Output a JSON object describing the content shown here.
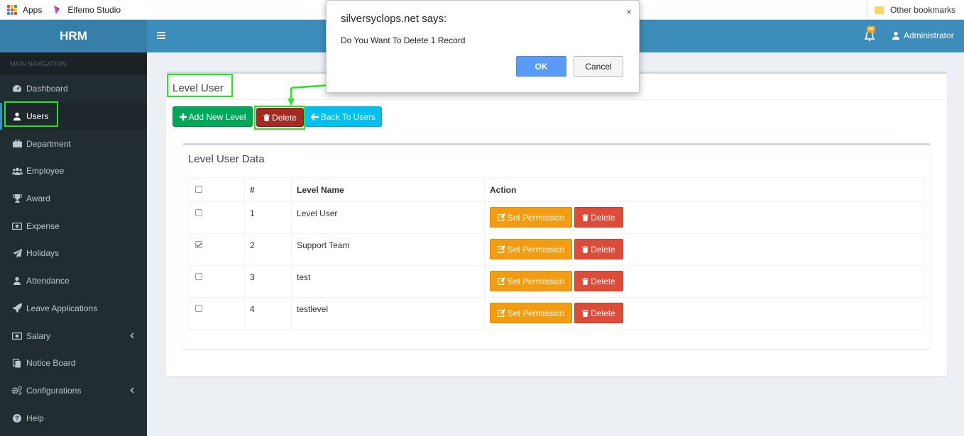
{
  "bookmarks": {
    "apps_label": "Apps",
    "elfemo_label": "Elfemo Studio",
    "other_label": "Other bookmarks"
  },
  "sidebar": {
    "logo": "HRM",
    "header": "MAIN NAVIGATION",
    "items": [
      {
        "label": "Dashboard",
        "icon": "dashboard-icon"
      },
      {
        "label": "Users",
        "icon": "user-icon"
      },
      {
        "label": "Department",
        "icon": "briefcase-icon"
      },
      {
        "label": "Employee",
        "icon": "users-icon"
      },
      {
        "label": "Award",
        "icon": "trophy-icon"
      },
      {
        "label": "Expense",
        "icon": "money-icon"
      },
      {
        "label": "Holidays",
        "icon": "paper-plane-icon"
      },
      {
        "label": "Attendance",
        "icon": "user-icon"
      },
      {
        "label": "Leave Applications",
        "icon": "rocket-icon"
      },
      {
        "label": "Salary",
        "icon": "money-icon"
      },
      {
        "label": "Notice Board",
        "icon": "files-icon"
      },
      {
        "label": "Configurations",
        "icon": "gears-icon"
      },
      {
        "label": "Help",
        "icon": "question-icon"
      }
    ]
  },
  "navbar": {
    "notification_count": "45",
    "user": "Administrator"
  },
  "page": {
    "title": "Level User",
    "add_button": "Add New Level",
    "delete_button": "Delete",
    "back_button": "Back To Users"
  },
  "table": {
    "title": "Level User Data",
    "headers": [
      "#",
      "Level Name",
      "Action"
    ],
    "rows": [
      {
        "num": "1",
        "name": "Level User",
        "checked": false
      },
      {
        "num": "2",
        "name": "Support Team",
        "checked": true
      },
      {
        "num": "3",
        "name": "test",
        "checked": false
      },
      {
        "num": "4",
        "name": "testlevel",
        "checked": false
      }
    ],
    "permission_label": "Set Permission",
    "delete_label": "Delete"
  },
  "dialog": {
    "title": "silversyclops.net says:",
    "message": "Do You Want To Delete 1 Record",
    "ok": "OK",
    "cancel": "Cancel",
    "close": "×"
  },
  "colors": {
    "highlight": "#22e822",
    "navbar": "#3c8dbc",
    "sidebar": "#222d32"
  }
}
